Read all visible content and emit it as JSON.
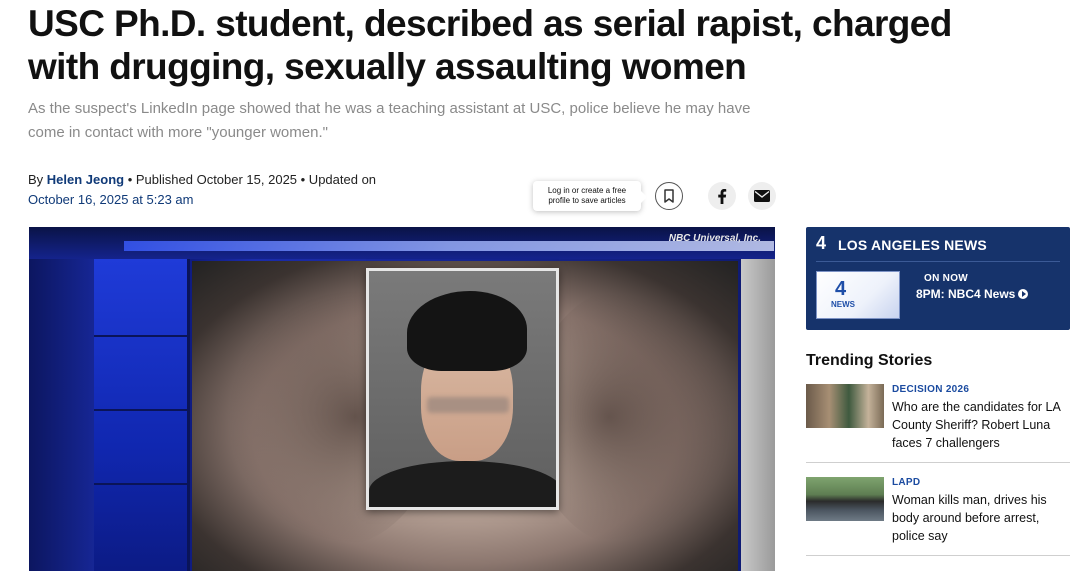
{
  "article": {
    "headline": "USC Ph.D. student, described as serial rapist, charged with drugging, sexually assaulting women",
    "dek": "As the suspect's LinkedIn page showed that he was a teaching assistant at USC, police believe he may have come in contact with more \"younger women.\"",
    "byline": {
      "by": "By ",
      "author": "Helen Jeong",
      "published_prefix": " • Published October 15, 2025 • Updated on",
      "updated": "October 16, 2025 at 5:23 am"
    },
    "image_credit": "NBC Universal, Inc."
  },
  "share": {
    "tooltip_line1": "Log in or create a free",
    "tooltip_line2": "profile to save articles",
    "icons": [
      "bookmark-icon",
      "facebook-icon",
      "mail-icon"
    ]
  },
  "sidebar": {
    "news_card": {
      "logo": "4",
      "brand": "LOS ANGELES NEWS",
      "thumb_logo": "4",
      "thumb_label": "NEWS",
      "on_now": "ON NOW",
      "show": "8PM: NBC4 News"
    },
    "trending": {
      "title": "Trending Stories",
      "items": [
        {
          "tag": "DECISION 2026",
          "headline": "Who are the candidates for LA County Sheriff? Robert Luna faces 7 challengers"
        },
        {
          "tag": "LAPD",
          "headline": "Woman kills man, drives his body around before arrest, police say"
        }
      ]
    }
  },
  "colors": {
    "link_blue": "#103a78",
    "brand_navy": "#16336b",
    "tag_blue": "#1b4ba0",
    "dek_gray": "#8a8a8a"
  }
}
